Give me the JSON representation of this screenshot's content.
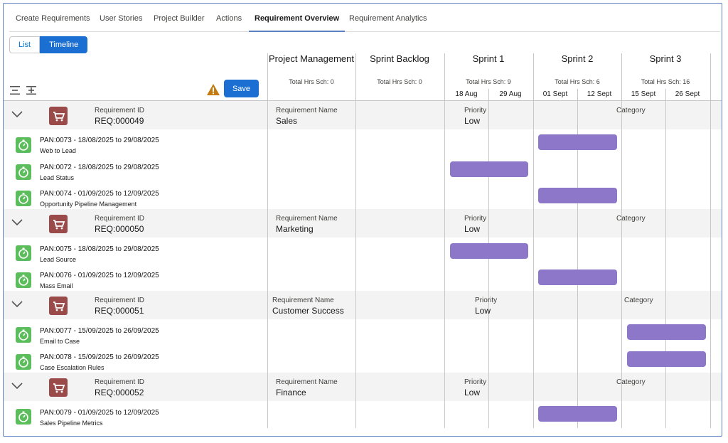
{
  "tabs": [
    {
      "label": "Create Requirements"
    },
    {
      "label": "User Stories"
    },
    {
      "label": "Project Builder"
    },
    {
      "label": "Actions"
    },
    {
      "label": "Requirement Overview"
    },
    {
      "label": "Requirement Analytics"
    }
  ],
  "active_tab": "Requirement Overview",
  "view_toggle": {
    "list": "List",
    "timeline": "Timeline",
    "selected": "Timeline"
  },
  "toolbar": {
    "save_label": "Save",
    "collapse_icon": "collapse-all-icon",
    "expand_icon": "expand-all-icon",
    "warning_icon": "warning-icon"
  },
  "columns": [
    {
      "title": "Project Management",
      "hours": "Total Hrs Sch: 0"
    },
    {
      "title": "Sprint Backlog",
      "hours": "Total Hrs Sch: 0"
    },
    {
      "title": "Sprint 1",
      "hours": "Total Hrs Sch: 9",
      "dates": [
        "18 Aug",
        "29 Aug"
      ]
    },
    {
      "title": "Sprint 2",
      "hours": "Total Hrs Sch: 6",
      "dates": [
        "01 Sept",
        "12 Sept"
      ]
    },
    {
      "title": "Sprint 3",
      "hours": "Total Hrs Sch: 16",
      "dates": [
        "15 Sept",
        "26 Sept"
      ]
    }
  ],
  "field_labels": {
    "id": "Requirement ID",
    "name": "Requirement Name",
    "priority": "Priority",
    "category": "Category"
  },
  "requirements": [
    {
      "id": "REQ:000049",
      "name": "Sales",
      "priority": "Low",
      "category": "",
      "tasks": [
        {
          "code": "PAN:0073 - 18/08/2025 to 29/08/2025",
          "title": "Web to Lead",
          "sprint": "Sprint 2"
        },
        {
          "code": "PAN:0072 - 18/08/2025 to 29/08/2025",
          "title": "Lead Status",
          "sprint": "Sprint 1"
        },
        {
          "code": "PAN:0074 - 01/09/2025 to 12/09/2025",
          "title": "Opportunity Pipeline Management",
          "sprint": "Sprint 2"
        }
      ]
    },
    {
      "id": "REQ:000050",
      "name": "Marketing",
      "priority": "Low",
      "category": "",
      "tasks": [
        {
          "code": "PAN:0075 - 18/08/2025 to 29/08/2025",
          "title": "Lead Source",
          "sprint": "Sprint 1"
        },
        {
          "code": "PAN:0076 - 01/09/2025 to 12/09/2025",
          "title": "Mass Email",
          "sprint": "Sprint 2"
        }
      ]
    },
    {
      "id": "REQ:000051",
      "name": "Customer Success",
      "priority": "Low",
      "category": "",
      "tasks": [
        {
          "code": "PAN:0077 - 15/09/2025 to 26/09/2025",
          "title": "Email to Case",
          "sprint": "Sprint 3"
        },
        {
          "code": "PAN:0078 - 15/09/2025 to 26/09/2025",
          "title": "Case Escalation Rules",
          "sprint": "Sprint 3"
        }
      ]
    },
    {
      "id": "REQ:000052",
      "name": "Finance",
      "priority": "Low",
      "category": "",
      "tasks": [
        {
          "code": "PAN:0079 - 01/09/2025 to 12/09/2025",
          "title": "Sales Pipeline Metrics",
          "sprint": "Sprint 2"
        }
      ]
    }
  ],
  "colors": {
    "accent": "#1b6fd2",
    "bar": "#8c77c9",
    "task_icon": "#5cbd5c",
    "req_icon": "#9b4a4a",
    "warning": "#c67a0e"
  }
}
